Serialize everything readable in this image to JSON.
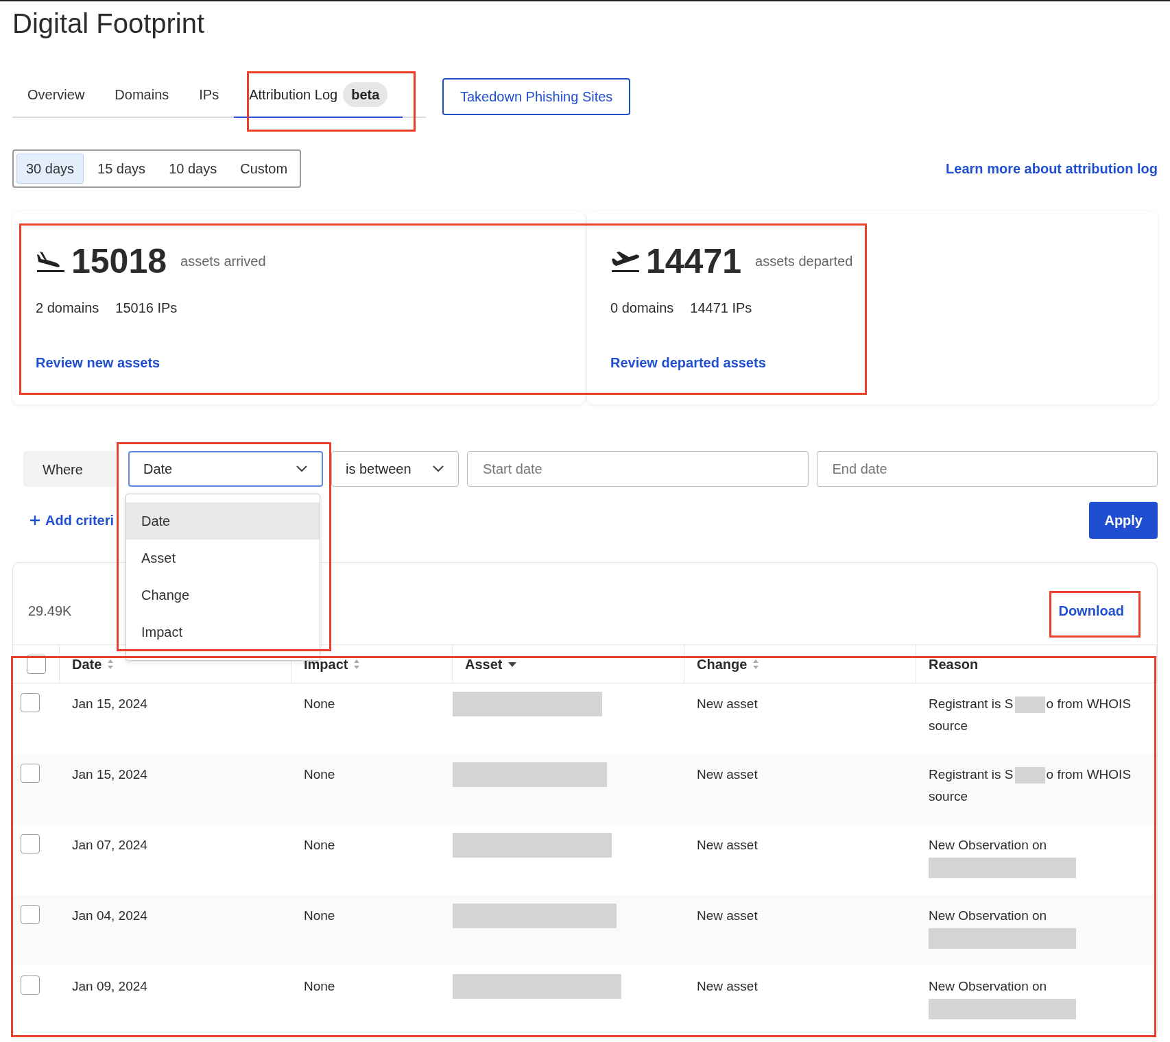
{
  "page_title": "Digital Footprint",
  "tabs": [
    {
      "label": "Overview",
      "selected": false
    },
    {
      "label": "Domains",
      "selected": false
    },
    {
      "label": "IPs",
      "selected": false
    },
    {
      "label": "Attribution Log",
      "badge": "beta",
      "selected": true
    }
  ],
  "takedown_button": "Takedown Phishing Sites",
  "ranges": [
    {
      "label": "30 days",
      "selected": true
    },
    {
      "label": "15 days",
      "selected": false
    },
    {
      "label": "10 days",
      "selected": false
    },
    {
      "label": "Custom",
      "selected": false
    }
  ],
  "learn_more_link": "Learn more about attribution log",
  "summary": [
    {
      "kind": "arrived",
      "count": "15018",
      "caption": "assets arrived",
      "domains": "2 domains",
      "ips": "15016 IPs",
      "link": "Review new assets"
    },
    {
      "kind": "departed",
      "count": "14471",
      "caption": "assets departed",
      "domains": "0 domains",
      "ips": "14471 IPs",
      "link": "Review departed assets"
    }
  ],
  "filter": {
    "where": "Where",
    "field": "Date",
    "field_expanded": true,
    "field_options": [
      {
        "label": "Date",
        "selected": true
      },
      {
        "label": "Asset",
        "selected": false
      },
      {
        "label": "Change",
        "selected": false
      },
      {
        "label": "Impact",
        "selected": false
      }
    ],
    "operator": "is between",
    "start_placeholder": "Start date",
    "end_placeholder": "End date",
    "add_criteria": "Add criteri",
    "apply": "Apply"
  },
  "results": {
    "count": "29.49K",
    "download": "Download",
    "all_checked": false,
    "columns": [
      {
        "label": "Date",
        "sortable": true,
        "sorted": false
      },
      {
        "label": "Impact",
        "sortable": true,
        "sorted": false
      },
      {
        "label": "Asset",
        "sorted": true
      },
      {
        "label": "Change",
        "sortable": true,
        "sorted": false
      },
      {
        "label": "Reason",
        "sortable": false
      }
    ],
    "rows": [
      {
        "checked": false,
        "date": "Jan 15, 2024",
        "impact": "None",
        "asset_redacted": true,
        "change": "New asset",
        "reason": [
          {
            "kind": "text",
            "text": "Registrant is S"
          },
          {
            "kind": "redacted"
          },
          {
            "kind": "text",
            "text": "o from WHOIS source"
          }
        ]
      },
      {
        "checked": false,
        "date": "Jan 15, 2024",
        "impact": "None",
        "asset_redacted": true,
        "change": "New asset",
        "reason": [
          {
            "kind": "text",
            "text": "Registrant is S"
          },
          {
            "kind": "redacted"
          },
          {
            "kind": "text",
            "text": "o from WHOIS source"
          }
        ]
      },
      {
        "checked": false,
        "date": "Jan 07, 2024",
        "impact": "None",
        "asset_redacted": true,
        "change": "New asset",
        "reason": [
          {
            "kind": "text",
            "text": "New Observation on"
          },
          {
            "kind": "redacted_line"
          }
        ]
      },
      {
        "checked": false,
        "date": "Jan 04, 2024",
        "impact": "None",
        "asset_redacted": true,
        "change": "New asset",
        "reason": [
          {
            "kind": "text",
            "text": "New Observation on"
          },
          {
            "kind": "redacted_line"
          }
        ]
      },
      {
        "checked": false,
        "date": "Jan 09, 2024",
        "impact": "None",
        "asset_redacted": true,
        "change": "New asset",
        "reason": [
          {
            "kind": "text",
            "text": "New Observation on"
          },
          {
            "kind": "redacted_line"
          }
        ]
      }
    ]
  }
}
